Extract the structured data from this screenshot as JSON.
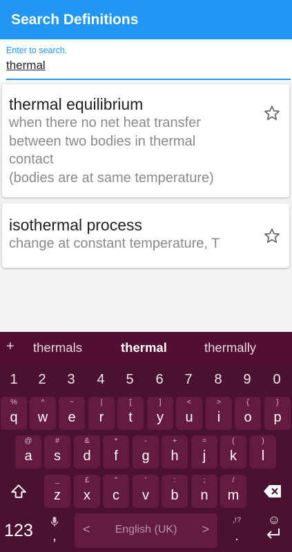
{
  "appbar": {
    "title": "Search Definitions"
  },
  "search": {
    "hint": "Enter to search.",
    "value": "thermal"
  },
  "results": [
    {
      "term": "thermal equilibrium",
      "definition": "when there no net heat transfer\nbetween two bodies in thermal\ncontact\n(bodies are at  same temperature)",
      "starred": false
    },
    {
      "term": "isothermal process",
      "definition": "change at constant temperature, T",
      "starred": false
    }
  ],
  "keyboard": {
    "plus": "+",
    "suggestions": [
      "thermals",
      "thermal",
      "thermally"
    ],
    "numbers": [
      "1",
      "2",
      "3",
      "4",
      "5",
      "6",
      "7",
      "8",
      "9",
      "0"
    ],
    "row1": [
      {
        "sym": "%",
        "ch": "q"
      },
      {
        "sym": "^",
        "ch": "w"
      },
      {
        "sym": "~",
        "ch": "e"
      },
      {
        "sym": "|",
        "ch": "r"
      },
      {
        "sym": "[",
        "ch": "t"
      },
      {
        "sym": "]",
        "ch": "y"
      },
      {
        "sym": "<",
        "ch": "u"
      },
      {
        "sym": ">",
        "ch": "i"
      },
      {
        "sym": "{",
        "ch": "o"
      },
      {
        "sym": "}",
        "ch": "p"
      }
    ],
    "row2": [
      {
        "sym": "@",
        "ch": "a"
      },
      {
        "sym": "#",
        "ch": "s"
      },
      {
        "sym": "&",
        "ch": "d"
      },
      {
        "sym": "*",
        "ch": "f"
      },
      {
        "sym": "-",
        "ch": "g"
      },
      {
        "sym": "+",
        "ch": "h"
      },
      {
        "sym": "=",
        "ch": "j"
      },
      {
        "sym": "(",
        "ch": "k"
      },
      {
        "sym": ")",
        "ch": "l"
      }
    ],
    "row3": [
      {
        "sym": "_",
        "ch": "z"
      },
      {
        "sym": "£",
        "ch": "x"
      },
      {
        "sym": "\"",
        "ch": "c"
      },
      {
        "sym": "'",
        "ch": "v"
      },
      {
        "sym": ":",
        "ch": "b"
      },
      {
        "sym": ";",
        "ch": "n"
      },
      {
        "sym": "/",
        "ch": "m"
      }
    ],
    "symbols_key": "123",
    "comma": ",",
    "period": ".",
    "period_sym": ",!?",
    "space_label": "English (UK)",
    "lang_prev": "<",
    "lang_next": ">"
  },
  "colors": {
    "accent": "#2196f3",
    "keyboard_bg": "#4b1130",
    "key_bg": "#651a41"
  }
}
